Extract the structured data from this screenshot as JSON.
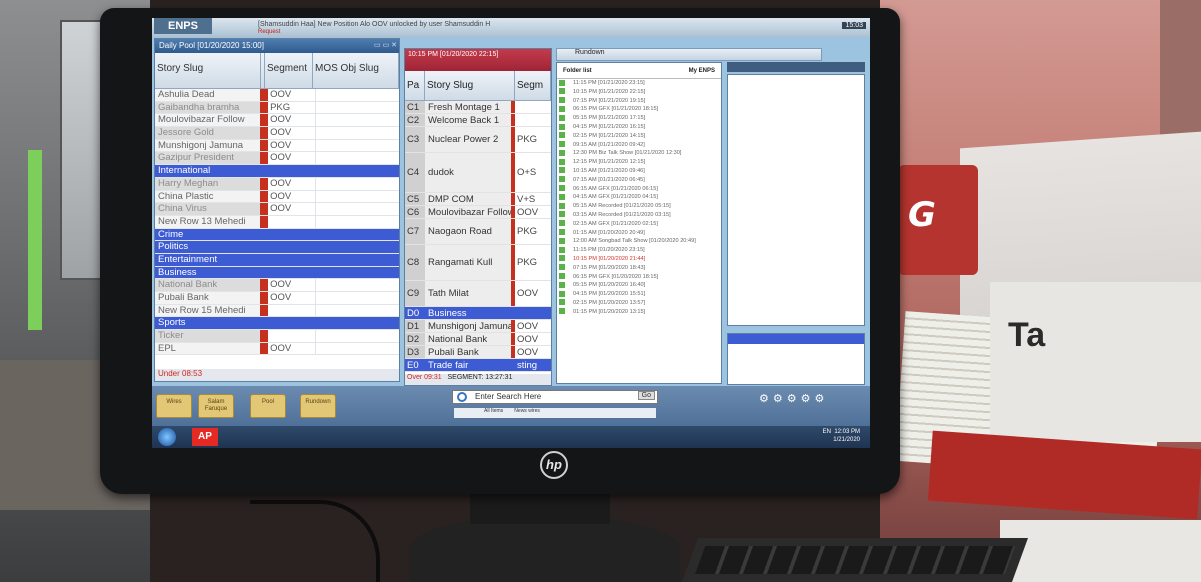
{
  "topbar": {
    "wordmark": "ENPS",
    "notice": "[Shamsuddin Haa] New Position Alo OOV unlocked by user Shamsuddin H",
    "request": "Request",
    "clock": "15:03"
  },
  "pool": {
    "title": "Daily Pool [01/20/2020 15:00]",
    "headers": {
      "slug": "Story Slug",
      "segment": "Segment",
      "mos": "MOS Obj Slug"
    },
    "rows": [
      {
        "slug": "Ashulia Dead",
        "seg": "OOV",
        "kind": "normal"
      },
      {
        "slug": "Gaibandha bramha",
        "seg": "PKG",
        "kind": "alt"
      },
      {
        "slug": "Moulovibazar Follow",
        "seg": "OOV",
        "kind": "normal"
      },
      {
        "slug": "Jessore Gold",
        "seg": "OOV",
        "kind": "alt"
      },
      {
        "slug": "Munshigonj Jamuna",
        "seg": "OOV",
        "kind": "normal"
      },
      {
        "slug": "Gazipur President",
        "seg": "OOV",
        "kind": "alt"
      },
      {
        "slug": "International",
        "seg": "",
        "kind": "blue"
      },
      {
        "slug": "Harry Meghan",
        "seg": "OOV",
        "kind": "alt"
      },
      {
        "slug": "China Plastic",
        "seg": "OOV",
        "kind": "normal"
      },
      {
        "slug": "China Virus",
        "seg": "OOV",
        "kind": "alt"
      },
      {
        "slug": "New Row 13 Mehedi",
        "seg": "",
        "kind": "normal"
      },
      {
        "slug": "Crime",
        "seg": "",
        "kind": "blue"
      },
      {
        "slug": "Politics",
        "seg": "",
        "kind": "blue"
      },
      {
        "slug": "Entertainment",
        "seg": "",
        "kind": "blue"
      },
      {
        "slug": "Business",
        "seg": "",
        "kind": "blue"
      },
      {
        "slug": "National Bank",
        "seg": "OOV",
        "kind": "alt"
      },
      {
        "slug": "Pubali Bank",
        "seg": "OOV",
        "kind": "normal"
      },
      {
        "slug": "New Row 15 Mehedi",
        "seg": "",
        "kind": "normal"
      },
      {
        "slug": "Sports",
        "seg": "",
        "kind": "blue"
      },
      {
        "slug": "Ticker",
        "seg": "",
        "kind": "alt"
      },
      {
        "slug": "EPL",
        "seg": "OOV",
        "kind": "normal"
      }
    ],
    "footer": "Under 08:53"
  },
  "rundown": {
    "title": "10:15 PM [01/20/2020 22:15]",
    "headers": {
      "page": "Pa",
      "slug": "Story Slug",
      "segment": "Segm"
    },
    "rows": [
      {
        "page": "C1",
        "slug": "Fresh Montage 1",
        "seg": "",
        "h": 13,
        "kind": "normal"
      },
      {
        "page": "C2",
        "slug": "Welcome Back 1",
        "seg": "",
        "h": 13,
        "kind": "normal"
      },
      {
        "page": "C3",
        "slug": "Nuclear Power 2",
        "seg": "PKG",
        "h": 26,
        "kind": "normal"
      },
      {
        "page": "C4",
        "slug": "dudok",
        "seg": "O+S",
        "h": 40,
        "kind": "normal"
      },
      {
        "page": "C5",
        "slug": "DMP COM",
        "seg": "V+S",
        "h": 13,
        "kind": "normal"
      },
      {
        "page": "C6",
        "slug": "Moulovibazar Follow",
        "seg": "OOV",
        "h": 13,
        "kind": "normal"
      },
      {
        "page": "C7",
        "slug": "Naogaon Road",
        "seg": "PKG",
        "h": 26,
        "kind": "normal"
      },
      {
        "page": "C8",
        "slug": "Rangamati Kull",
        "seg": "PKG",
        "h": 36,
        "kind": "normal"
      },
      {
        "page": "C9",
        "slug": "Tath Milat",
        "seg": "OOV",
        "h": 26,
        "kind": "normal"
      },
      {
        "page": "D0",
        "slug": "Business",
        "seg": "",
        "h": 13,
        "kind": "blue"
      },
      {
        "page": "D1",
        "slug": "Munshigonj Jamuna",
        "seg": "OOV",
        "h": 13,
        "kind": "normal"
      },
      {
        "page": "D2",
        "slug": "National Bank",
        "seg": "OOV",
        "h": 13,
        "kind": "normal"
      },
      {
        "page": "D3",
        "slug": "Pubali Bank",
        "seg": "OOV",
        "h": 13,
        "kind": "normal"
      },
      {
        "page": "E0",
        "slug": "Trade fair",
        "seg": "sting",
        "h": 13,
        "kind": "blue"
      }
    ],
    "footer_over": "Over 09:31",
    "footer_seg": "SEGMENT: 13:27:31"
  },
  "rundown_bar": "Rundown",
  "folders": {
    "header_left": "Folder list",
    "header_right": "My ENPS",
    "items": [
      {
        "label": "11:15 PM [01/21/2020 23:15]",
        "kind": "normal"
      },
      {
        "label": "10:15 PM [01/21/2020 22:15]",
        "kind": "normal"
      },
      {
        "label": "07:15 PM [01/21/2020 19:15]",
        "kind": "normal"
      },
      {
        "label": "06:15 PM GFX [01/21/2020 18:15]",
        "kind": "normal"
      },
      {
        "label": "05:15 PM [01/21/2020 17:15]",
        "kind": "normal"
      },
      {
        "label": "04:15 PM [01/21/2020 16:15]",
        "kind": "normal"
      },
      {
        "label": "02:15 PM [01/21/2020 14:15]",
        "kind": "normal"
      },
      {
        "label": "09:15 AM [01/21/2020 09:42]",
        "kind": "normal"
      },
      {
        "label": "12:30 PM Biz Talk Show [01/21/2020 12:30]",
        "kind": "normal"
      },
      {
        "label": "12:15 PM [01/21/2020 12:15]",
        "kind": "normal"
      },
      {
        "label": "10:15 AM [01/21/2020 09:46]",
        "kind": "normal"
      },
      {
        "label": "07:15 AM [01/21/2020 06:45]",
        "kind": "normal"
      },
      {
        "label": "06:15 AM GFX [01/21/2020 06:15]",
        "kind": "normal"
      },
      {
        "label": "04:15 AM GFX [01/21/2020 04:15]",
        "kind": "normal"
      },
      {
        "label": "05:15 AM Recorded [01/21/2020 05:15]",
        "kind": "normal"
      },
      {
        "label": "03:15 AM Recorded [01/21/2020 03:15]",
        "kind": "normal"
      },
      {
        "label": "02:15 AM GFX [01/21/2020 02:15]",
        "kind": "normal"
      },
      {
        "label": "01:15 AM [01/20/2020 20:49]",
        "kind": "normal"
      },
      {
        "label": "12:00 AM Songbad Talk Show [01/20/2020 20:49]",
        "kind": "normal"
      },
      {
        "label": "11:15 PM [01/20/2020 23:15]",
        "kind": "normal"
      },
      {
        "label": "10:15 PM [01/20/2020 21:44]",
        "kind": "red"
      },
      {
        "label": "07:15 PM [01/20/2020 18:43]",
        "kind": "normal"
      },
      {
        "label": "06:15 PM GFX [01/20/2020 18:15]",
        "kind": "normal"
      },
      {
        "label": "05:15 PM [01/20/2020 16:40]",
        "kind": "normal"
      },
      {
        "label": "04:15 PM [01/20/2020 15:51]",
        "kind": "normal"
      },
      {
        "label": "02:15 PM [01/20/2020 13:57]",
        "kind": "normal"
      },
      {
        "label": "01:15 PM [01/20/2020 13:15]",
        "kind": "normal"
      }
    ]
  },
  "dock": {
    "folders": [
      "Wires",
      "Salam Faruque",
      "Pool",
      "Rundown"
    ],
    "search_placeholder": "Enter Search Here",
    "go": "Go",
    "search_scope": "All Items",
    "search_type": "News wires"
  },
  "taskbar": {
    "ap": "AP",
    "lang": "EN",
    "time": "12:03 PM",
    "date": "1/21/2020"
  },
  "room": {
    "logo_text": "G",
    "paper_text": "Ta"
  }
}
